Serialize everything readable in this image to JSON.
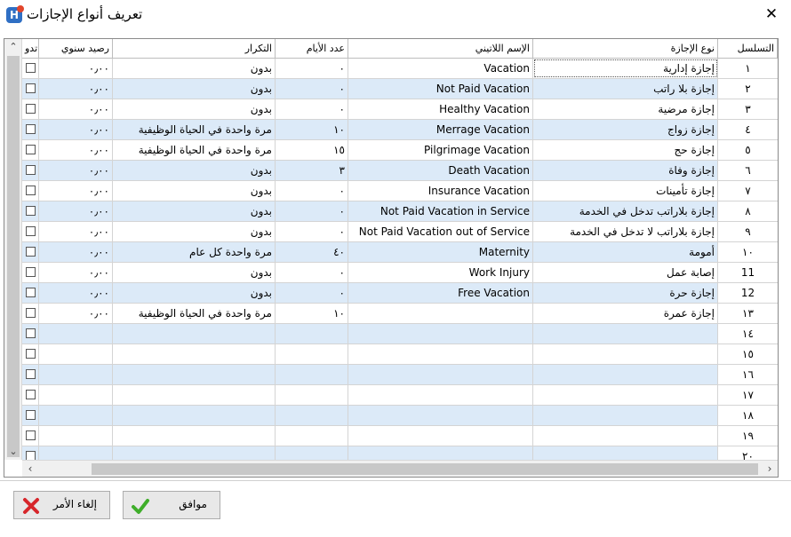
{
  "window": {
    "title": "تعريف أنواع الإجازات",
    "close_glyph": "✕",
    "app_icon_letter": "H"
  },
  "grid": {
    "columns": {
      "seq": "التسلسل",
      "name": "نوع الإجازة",
      "latin": "الإسم اللاتيني",
      "days": "عدد الأيام",
      "repeat": "التكرار",
      "balance": "رصيد سنوي",
      "extra": "تدو"
    },
    "rows": [
      {
        "seq": "١",
        "name": "إجازة إدارية",
        "latin": "Vacation",
        "days": "٠",
        "repeat": "بدون",
        "balance": "٠٫٠٠"
      },
      {
        "seq": "٢",
        "name": "إجازة بلا راتب",
        "latin": "Not Paid Vacation",
        "days": "٠",
        "repeat": "بدون",
        "balance": "٠٫٠٠"
      },
      {
        "seq": "٣",
        "name": "إجازة مرضية",
        "latin": "Healthy Vacation",
        "days": "٠",
        "repeat": "بدون",
        "balance": "٠٫٠٠"
      },
      {
        "seq": "٤",
        "name": "إجازة زواج",
        "latin": "Merrage Vacation",
        "days": "١٠",
        "repeat": "مرة واحدة في الحياة الوظيفية",
        "balance": "٠٫٠٠"
      },
      {
        "seq": "٥",
        "name": "إجازة حج",
        "latin": "Pilgrimage Vacation",
        "days": "١٥",
        "repeat": "مرة واحدة في الحياة الوظيفية",
        "balance": "٠٫٠٠"
      },
      {
        "seq": "٦",
        "name": "إجازة وفاة",
        "latin": "Death Vacation",
        "days": "٣",
        "repeat": "بدون",
        "balance": "٠٫٠٠"
      },
      {
        "seq": "٧",
        "name": "إجازة تأمينات",
        "latin": "Insurance Vacation",
        "days": "٠",
        "repeat": "بدون",
        "balance": "٠٫٠٠"
      },
      {
        "seq": "٨",
        "name": "إجازة بلاراتب تدخل في الخدمة",
        "latin": "Not Paid Vacation in Service",
        "days": "٠",
        "repeat": "بدون",
        "balance": "٠٫٠٠"
      },
      {
        "seq": "٩",
        "name": "إجازة بلاراتب لا تدخل في الخدمة",
        "latin": "Not Paid Vacation out of Service",
        "days": "٠",
        "repeat": "بدون",
        "balance": "٠٫٠٠"
      },
      {
        "seq": "١٠",
        "name": "أمومة",
        "latin": "Maternity",
        "days": "٤٠",
        "repeat": "مرة واحدة كل عام",
        "balance": "٠٫٠٠"
      },
      {
        "seq": "11",
        "name": "إصابة عمل",
        "latin": "Work Injury",
        "days": "٠",
        "repeat": "بدون",
        "balance": "٠٫٠٠"
      },
      {
        "seq": "12",
        "name": "إجازة حرة",
        "latin": "Free Vacation",
        "days": "٠",
        "repeat": "بدون",
        "balance": "٠٫٠٠"
      },
      {
        "seq": "١٣",
        "name": "إجازة عمرة",
        "latin": "",
        "days": "١٠",
        "repeat": "مرة واحدة في الحياة الوظيفية",
        "balance": "٠٫٠٠"
      },
      {
        "seq": "١٤",
        "name": "",
        "latin": "",
        "days": "",
        "repeat": "",
        "balance": ""
      },
      {
        "seq": "١٥",
        "name": "",
        "latin": "",
        "days": "",
        "repeat": "",
        "balance": ""
      },
      {
        "seq": "١٦",
        "name": "",
        "latin": "",
        "days": "",
        "repeat": "",
        "balance": ""
      },
      {
        "seq": "١٧",
        "name": "",
        "latin": "",
        "days": "",
        "repeat": "",
        "balance": ""
      },
      {
        "seq": "١٨",
        "name": "",
        "latin": "",
        "days": "",
        "repeat": "",
        "balance": ""
      },
      {
        "seq": "١٩",
        "name": "",
        "latin": "",
        "days": "",
        "repeat": "",
        "balance": ""
      },
      {
        "seq": "٢٠",
        "name": "",
        "latin": "",
        "days": "",
        "repeat": "",
        "balance": ""
      }
    ]
  },
  "buttons": {
    "ok": "موافق",
    "cancel": "إلغاء الأمر"
  },
  "icons": {
    "ok": "check-icon",
    "cancel": "cross-icon",
    "close": "close-icon"
  },
  "colors": {
    "alt_row": "#dceaf8",
    "ok_green": "#3fae2a",
    "cancel_red": "#d7262b",
    "app_icon": "#2f6fc4"
  }
}
